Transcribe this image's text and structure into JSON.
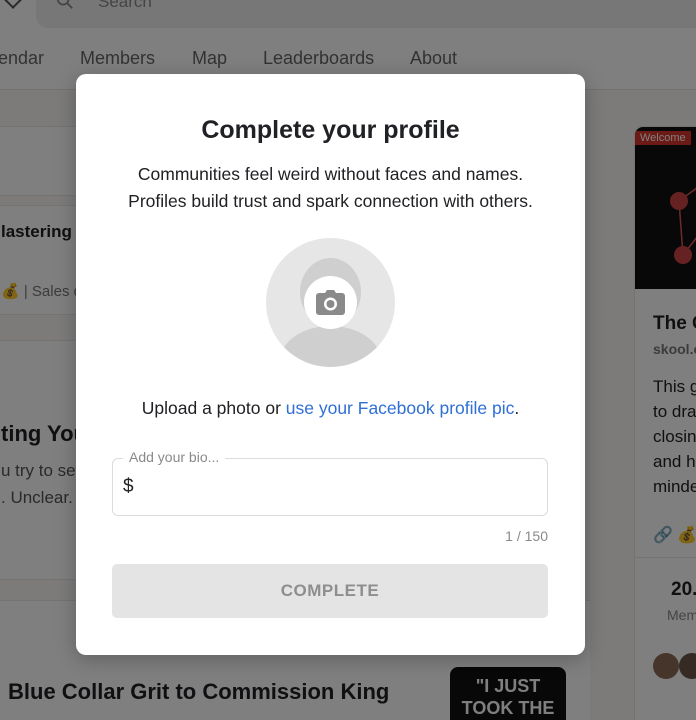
{
  "background": {
    "search": {
      "placeholder": "Search"
    },
    "nav": [
      "endar",
      "Members",
      "Map",
      "Leaderboards",
      "About"
    ],
    "left": {
      "post_title_fragment": "lastering t",
      "post_meta_fragment": "| Sales qu",
      "article_title_fragment": "ting You",
      "article_line1": "u try to set",
      "article_line2": ". Unclear."
    },
    "right_card": {
      "welcome_tag": "Welcome",
      "title_fragment": "The C",
      "domain_fragment": "skool.c",
      "desc_lines": [
        "This g",
        "to dra",
        "closin",
        "and h",
        "minde"
      ],
      "stat_value": "20.",
      "stat_label": "Mem"
    },
    "bottom_post": {
      "title": "Blue Collar Grit to Commission King",
      "thumb_lines": [
        "\"I JUST",
        "TOOK THE"
      ]
    }
  },
  "modal": {
    "title": "Complete your profile",
    "description_lines": [
      "Communities feel weird without faces and names.",
      "Profiles build trust and spark connection with others."
    ],
    "avatar_icon": "camera-icon",
    "upload_text": "Upload a photo or ",
    "facebook_link": "use your Facebook profile pic",
    "upload_suffix": ".",
    "bio": {
      "label": "Add your bio...",
      "value": "$",
      "char_count": "1 / 150"
    },
    "complete_button": "COMPLETE"
  },
  "colors": {
    "link": "#2f6fd6",
    "button_disabled_bg": "#e4e4e4",
    "button_disabled_text": "#8e8e8e",
    "welcome_tag": "#d9342b"
  }
}
